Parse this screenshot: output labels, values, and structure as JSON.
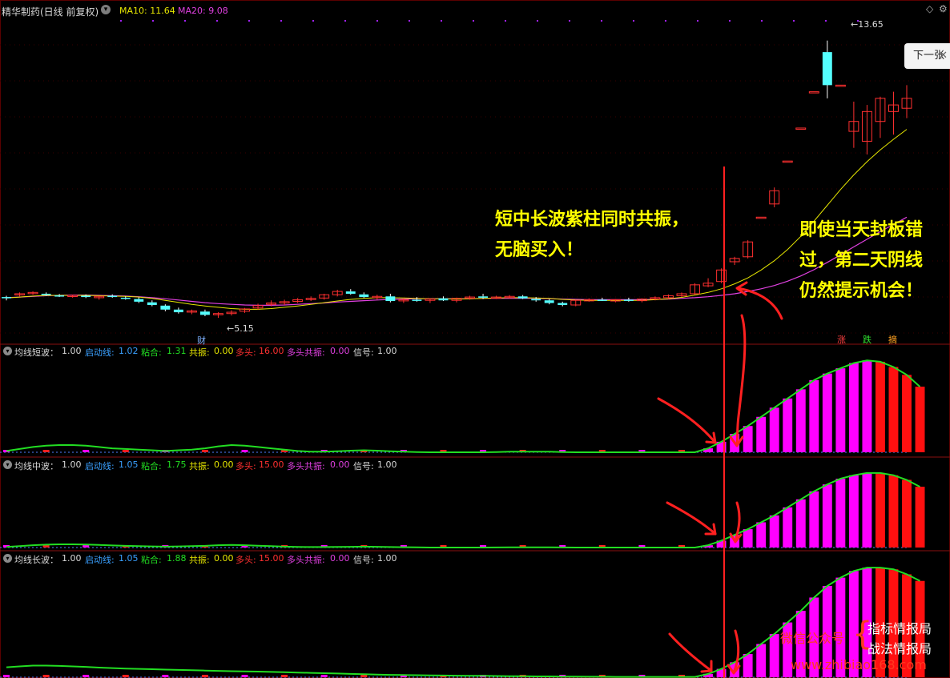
{
  "header": {
    "stock_name": "精华制药(日线 前复权)",
    "menu_icon": "chevron-down-icon",
    "ma10": "MA10: 11.64",
    "ma20": "MA20: 9.08"
  },
  "main_chart": {
    "next_button": "下一张",
    "next_button_icon": "close-icon",
    "high_label": "13.65",
    "low_label": "5.15",
    "finance_marker": "财",
    "tags": [
      "涨",
      "跌",
      "摘"
    ],
    "price_range": [
      4.5,
      14.2
    ]
  },
  "colors": {
    "up": "#ff3030",
    "down": "#54ffff",
    "ma10": "#e6e600",
    "ma20": "#e040e0",
    "indicator_line": "#22dd22",
    "purple_bar": "#ff00ff",
    "red_bar": "#ff1010",
    "annotation": "#ffff00",
    "arrow": "#ff2020"
  },
  "panels": [
    {
      "name": "均线短波",
      "fields": [
        {
          "label": "均线短波：",
          "value": "1.00",
          "color": "#d8d8d8"
        },
        {
          "label": "启动线: ",
          "value": "1.02",
          "color": "#3aa0ff"
        },
        {
          "label": "粘合: ",
          "value": "1.31",
          "color": "#22dd22"
        },
        {
          "label": "共振: ",
          "value": "0.00",
          "color": "#e6e600"
        },
        {
          "label": "多头: ",
          "value": "16.00",
          "color": "#ff3030"
        },
        {
          "label": "多头共振: ",
          "value": "0.00",
          "color": "#e040e0"
        },
        {
          "label": "信号: ",
          "value": "1.00",
          "color": "#d8d8d8"
        }
      ]
    },
    {
      "name": "均线中波",
      "fields": [
        {
          "label": "均线中波：",
          "value": "1.00",
          "color": "#d8d8d8"
        },
        {
          "label": "启动线: ",
          "value": "1.05",
          "color": "#3aa0ff"
        },
        {
          "label": "粘合: ",
          "value": "1.75",
          "color": "#22dd22"
        },
        {
          "label": "共振: ",
          "value": "0.00",
          "color": "#e6e600"
        },
        {
          "label": "多头: ",
          "value": "15.00",
          "color": "#ff3030"
        },
        {
          "label": "多头共振: ",
          "value": "0.00",
          "color": "#e040e0"
        },
        {
          "label": "信号: ",
          "value": "1.00",
          "color": "#d8d8d8"
        }
      ]
    },
    {
      "name": "均线长波",
      "fields": [
        {
          "label": "均线长波：",
          "value": "1.00",
          "color": "#d8d8d8"
        },
        {
          "label": "启动线: ",
          "value": "1.05",
          "color": "#3aa0ff"
        },
        {
          "label": "粘合: ",
          "value": "1.88",
          "color": "#22dd22"
        },
        {
          "label": "共振: ",
          "value": "0.00",
          "color": "#e6e600"
        },
        {
          "label": "多头: ",
          "value": "15.00",
          "color": "#ff3030"
        },
        {
          "label": "多头共振: ",
          "value": "0.00",
          "color": "#e040e0"
        },
        {
          "label": "信号: ",
          "value": "1.00",
          "color": "#d8d8d8"
        }
      ]
    }
  ],
  "annotations": {
    "left_line1": "短中长波紫柱同时共振，",
    "left_line2": "无脑买入！",
    "right_line1": "即使当天封板错",
    "right_line2": "过，第二天阴线",
    "right_line3": "仍然提示机会！"
  },
  "watermark": {
    "account_label": "微信公众号",
    "name1": "指标情报局",
    "name2": "战法情报局",
    "url": "www.zhibiao168.com"
  },
  "chart_data": {
    "type": "candlestick",
    "ohlc": [
      [
        5.88,
        5.92,
        5.78,
        5.85
      ],
      [
        5.95,
        6.02,
        5.9,
        5.98
      ],
      [
        6.0,
        6.05,
        5.95,
        6.02
      ],
      [
        5.98,
        6.02,
        5.92,
        5.95
      ],
      [
        5.93,
        5.97,
        5.88,
        5.9
      ],
      [
        5.9,
        5.95,
        5.86,
        5.93
      ],
      [
        5.92,
        5.96,
        5.85,
        5.88
      ],
      [
        5.86,
        5.91,
        5.8,
        5.9
      ],
      [
        5.92,
        5.96,
        5.86,
        5.88
      ],
      [
        5.86,
        5.9,
        5.8,
        5.84
      ],
      [
        5.82,
        5.87,
        5.7,
        5.74
      ],
      [
        5.72,
        5.78,
        5.6,
        5.64
      ],
      [
        5.62,
        5.66,
        5.45,
        5.5
      ],
      [
        5.5,
        5.56,
        5.38,
        5.42
      ],
      [
        5.44,
        5.5,
        5.36,
        5.46
      ],
      [
        5.44,
        5.5,
        5.3,
        5.34
      ],
      [
        5.36,
        5.42,
        5.25,
        5.38
      ],
      [
        5.38,
        5.48,
        5.32,
        5.42
      ],
      [
        5.45,
        5.55,
        5.4,
        5.52
      ],
      [
        5.55,
        5.68,
        5.5,
        5.62
      ],
      [
        5.66,
        5.78,
        5.6,
        5.7
      ],
      [
        5.7,
        5.8,
        5.64,
        5.74
      ],
      [
        5.75,
        5.85,
        5.7,
        5.8
      ],
      [
        5.82,
        5.9,
        5.76,
        5.84
      ],
      [
        5.85,
        5.98,
        5.8,
        5.95
      ],
      [
        5.95,
        6.1,
        5.9,
        6.05
      ],
      [
        6.05,
        6.12,
        5.95,
        5.98
      ],
      [
        5.96,
        6.02,
        5.85,
        5.88
      ],
      [
        5.88,
        5.95,
        5.8,
        5.9
      ],
      [
        5.9,
        5.98,
        5.72,
        5.76
      ],
      [
        5.78,
        5.84,
        5.7,
        5.8
      ],
      [
        5.8,
        5.88,
        5.74,
        5.78
      ],
      [
        5.78,
        5.84,
        5.7,
        5.82
      ],
      [
        5.84,
        5.9,
        5.76,
        5.78
      ],
      [
        5.78,
        5.86,
        5.72,
        5.84
      ],
      [
        5.86,
        5.92,
        5.8,
        5.88
      ],
      [
        5.9,
        5.98,
        5.82,
        5.86
      ],
      [
        5.86,
        5.92,
        5.82,
        5.88
      ],
      [
        5.88,
        5.94,
        5.84,
        5.9
      ],
      [
        5.9,
        5.94,
        5.82,
        5.84
      ],
      [
        5.82,
        5.88,
        5.74,
        5.78
      ],
      [
        5.78,
        5.82,
        5.66,
        5.7
      ],
      [
        5.7,
        5.74,
        5.6,
        5.64
      ],
      [
        5.64,
        5.8,
        5.6,
        5.78
      ],
      [
        5.78,
        5.84,
        5.74,
        5.8
      ],
      [
        5.8,
        5.86,
        5.76,
        5.78
      ],
      [
        5.76,
        5.82,
        5.72,
        5.8
      ],
      [
        5.8,
        5.86,
        5.74,
        5.77
      ],
      [
        5.77,
        5.84,
        5.72,
        5.82
      ],
      [
        5.82,
        5.9,
        5.78,
        5.86
      ],
      [
        5.86,
        5.96,
        5.82,
        5.92
      ],
      [
        5.92,
        6.02,
        5.88,
        5.98
      ],
      [
        5.98,
        6.3,
        5.95,
        6.25
      ],
      [
        6.22,
        6.45,
        6.18,
        6.3
      ],
      [
        6.35,
        6.75,
        6.3,
        6.7
      ],
      [
        6.95,
        7.1,
        6.85,
        7.05
      ],
      [
        7.1,
        7.6,
        7.05,
        7.55
      ],
      [
        8.3,
        8.3,
        8.3,
        8.3
      ],
      [
        8.7,
        9.2,
        8.6,
        9.1
      ],
      [
        10.0,
        10.0,
        10.0,
        10.0
      ],
      [
        11.0,
        11.0,
        11.0,
        11.0
      ],
      [
        12.1,
        12.1,
        12.1,
        12.1
      ],
      [
        13.3,
        13.65,
        11.9,
        12.3
      ],
      [
        12.3,
        12.3,
        12.3,
        12.3
      ],
      [
        10.9,
        11.8,
        10.4,
        11.2
      ],
      [
        10.6,
        11.7,
        10.2,
        11.5
      ],
      [
        11.2,
        11.95,
        10.7,
        11.9
      ],
      [
        11.5,
        12.1,
        10.8,
        11.7
      ],
      [
        11.6,
        12.3,
        11.3,
        11.9
      ]
    ],
    "ma10": [
      5.85,
      5.88,
      5.91,
      5.93,
      5.93,
      5.93,
      5.93,
      5.92,
      5.91,
      5.9,
      5.88,
      5.84,
      5.78,
      5.72,
      5.66,
      5.61,
      5.57,
      5.53,
      5.51,
      5.51,
      5.53,
      5.57,
      5.61,
      5.66,
      5.71,
      5.76,
      5.81,
      5.84,
      5.86,
      5.86,
      5.85,
      5.84,
      5.83,
      5.83,
      5.82,
      5.83,
      5.84,
      5.85,
      5.86,
      5.86,
      5.85,
      5.84,
      5.81,
      5.79,
      5.78,
      5.78,
      5.78,
      5.78,
      5.78,
      5.8,
      5.83,
      5.87,
      5.94,
      6.02,
      6.13,
      6.28,
      6.46,
      6.7,
      6.98,
      7.32,
      7.72,
      8.18,
      8.66,
      9.14,
      9.58,
      9.98,
      10.34,
      10.66,
      10.96
    ],
    "ma20": [
      5.86,
      5.88,
      5.9,
      5.92,
      5.93,
      5.94,
      5.94,
      5.93,
      5.92,
      5.91,
      5.89,
      5.86,
      5.83,
      5.79,
      5.75,
      5.71,
      5.68,
      5.66,
      5.64,
      5.63,
      5.63,
      5.64,
      5.66,
      5.68,
      5.7,
      5.73,
      5.75,
      5.77,
      5.79,
      5.81,
      5.82,
      5.83,
      5.83,
      5.83,
      5.83,
      5.83,
      5.84,
      5.84,
      5.84,
      5.84,
      5.84,
      5.83,
      5.82,
      5.81,
      5.8,
      5.8,
      5.8,
      5.8,
      5.8,
      5.81,
      5.82,
      5.84,
      5.86,
      5.89,
      5.93,
      5.98,
      6.05,
      6.13,
      6.23,
      6.36,
      6.52,
      6.71,
      6.93,
      7.16,
      7.4,
      7.63,
      7.86,
      8.08,
      8.3
    ],
    "indicator_short": [
      0.1,
      0.25,
      0.4,
      0.5,
      0.55,
      0.55,
      0.5,
      0.4,
      0.3,
      0.25,
      0.2,
      0.15,
      0.1,
      0.15,
      0.2,
      0.3,
      0.45,
      0.55,
      0.5,
      0.4,
      0.3,
      0.2,
      0.1,
      0.05,
      0.05,
      0.08,
      0.12,
      0.15,
      0.12,
      0.08,
      0.05,
      0.02,
      0,
      0,
      0,
      0,
      0,
      0.02,
      0.04,
      0.05,
      0.05,
      0.04,
      0.02,
      0,
      0,
      0,
      0,
      0,
      0,
      0,
      0,
      0,
      0,
      0.3,
      0.8,
      1.4,
      2.0,
      2.7,
      3.4,
      4.1,
      4.8,
      5.5,
      6.0,
      6.4,
      6.8,
      7.0,
      6.9,
      6.5,
      5.9,
      5.0
    ],
    "indicator_mid": [
      0.05,
      0.12,
      0.2,
      0.25,
      0.28,
      0.28,
      0.26,
      0.22,
      0.18,
      0.15,
      0.12,
      0.1,
      0.08,
      0.1,
      0.12,
      0.15,
      0.2,
      0.22,
      0.2,
      0.16,
      0.12,
      0.08,
      0.05,
      0.04,
      0.04,
      0.05,
      0.06,
      0.08,
      0.06,
      0.04,
      0.03,
      0.02,
      0,
      0,
      0,
      0,
      0,
      0.01,
      0.02,
      0.02,
      0.02,
      0.02,
      0.01,
      0,
      0,
      0,
      0,
      0,
      0,
      0,
      0,
      0,
      0,
      0.2,
      0.6,
      1.1,
      1.6,
      2.2,
      2.8,
      3.5,
      4.2,
      4.9,
      5.5,
      6.0,
      6.3,
      6.5,
      6.5,
      6.3,
      5.9,
      5.3
    ],
    "indicator_long": [
      0.6,
      0.65,
      0.7,
      0.7,
      0.68,
      0.65,
      0.62,
      0.58,
      0.55,
      0.52,
      0.5,
      0.48,
      0.46,
      0.44,
      0.42,
      0.4,
      0.38,
      0.36,
      0.35,
      0.34,
      0.32,
      0.3,
      0.28,
      0.26,
      0.24,
      0.22,
      0.2,
      0.18,
      0.16,
      0.14,
      0.13,
      0.12,
      0.11,
      0.1,
      0.09,
      0.08,
      0.08,
      0.07,
      0.06,
      0.06,
      0.05,
      0.05,
      0.04,
      0.04,
      0.03,
      0.03,
      0.02,
      0.02,
      0.02,
      0.02,
      0.02,
      0.02,
      0.02,
      0.2,
      0.5,
      0.9,
      1.4,
      2.0,
      2.6,
      3.3,
      4.0,
      4.8,
      5.5,
      6.0,
      6.4,
      6.6,
      6.6,
      6.5,
      6.2,
      5.8
    ]
  }
}
